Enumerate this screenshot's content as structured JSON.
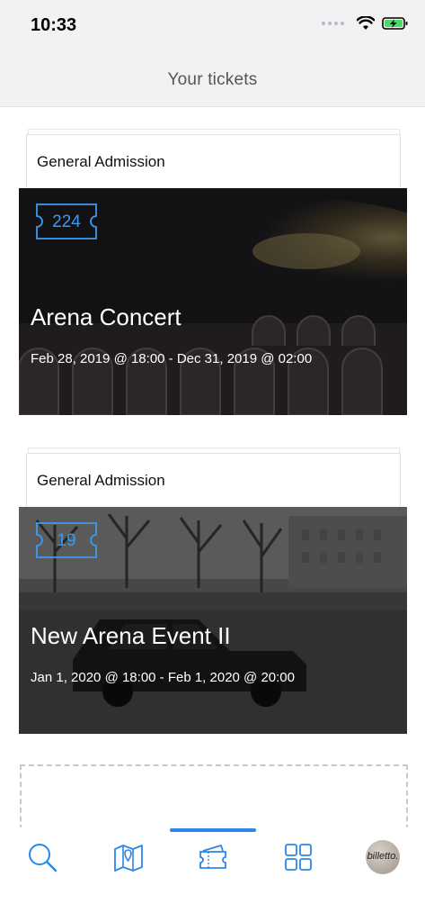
{
  "status_bar": {
    "time": "10:33",
    "icons": [
      "signal-dots-icon",
      "wifi-icon",
      "battery-charging-icon"
    ],
    "battery_color": "#4cd964"
  },
  "header": {
    "title": "Your tickets"
  },
  "tickets": [
    {
      "admission": "General Admission",
      "badge_count": "224",
      "event_title": "Arena Concert",
      "dates": "Feb 28, 2019 @ 18:00 - Dec 31, 2019 @ 02:00"
    },
    {
      "admission": "General Admission",
      "badge_count": "19",
      "event_title": "New Arena Event II",
      "dates": "Jan 1, 2020 @ 18:00 - Feb 1, 2020 @ 20:00"
    }
  ],
  "tab_bar": {
    "active_tab": "tickets",
    "accent_color": "#2a87e8",
    "tabs": [
      "search-icon",
      "map-icon",
      "tickets-icon",
      "grid-icon",
      "profile-avatar"
    ],
    "avatar_text": "billetto."
  }
}
